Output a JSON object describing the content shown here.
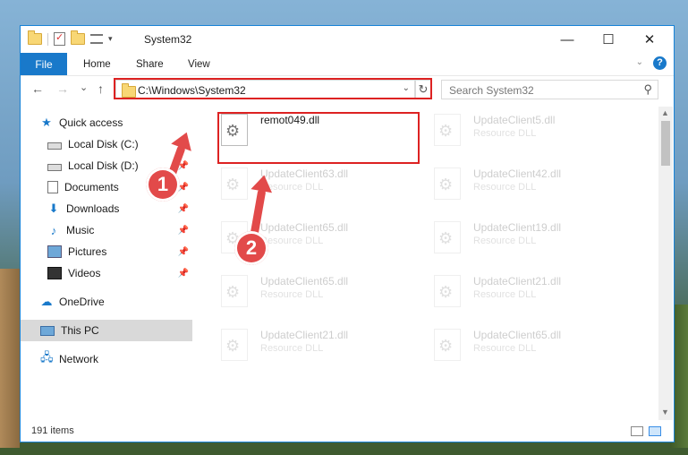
{
  "window": {
    "title": "System32",
    "controls": {
      "minimize": "—",
      "maximize": "☐",
      "close": "✕"
    }
  },
  "ribbon": {
    "tabs": [
      "File",
      "Home",
      "Share",
      "View"
    ],
    "help": "?"
  },
  "navigation": {
    "back": "←",
    "forward": "→",
    "recent": "⌄",
    "up": "↑",
    "address": "C:\\Windows\\System32",
    "refresh": "↻",
    "search_placeholder": "Search System32"
  },
  "sidebar": {
    "quick_access": "Quick access",
    "items": [
      {
        "label": "Local Disk (C:)",
        "icon": "drive-icon",
        "pinned": true
      },
      {
        "label": "Local Disk (D:)",
        "icon": "drive-icon",
        "pinned": true
      },
      {
        "label": "Documents",
        "icon": "documents-icon",
        "pinned": true
      },
      {
        "label": "Downloads",
        "icon": "downloads-icon",
        "pinned": true
      },
      {
        "label": "Music",
        "icon": "music-icon",
        "pinned": true
      },
      {
        "label": "Pictures",
        "icon": "pictures-icon",
        "pinned": true
      },
      {
        "label": "Videos",
        "icon": "videos-icon",
        "pinned": true
      }
    ],
    "onedrive": "OneDrive",
    "this_pc": "This PC",
    "network": "Network"
  },
  "files": [
    {
      "name": "remot049.dll",
      "type": "",
      "highlighted": true
    },
    {
      "name": "UpdateClient5.dll",
      "type": "Resource DLL"
    },
    {
      "name": "UpdateClient63.dll",
      "type": "Resource DLL"
    },
    {
      "name": "UpdateClient42.dll",
      "type": "Resource DLL"
    },
    {
      "name": "UpdateClient65.dll",
      "type": "Resource DLL"
    },
    {
      "name": "UpdateClient19.dll",
      "type": "Resource DLL"
    },
    {
      "name": "UpdateClient65.dll",
      "type": "Resource DLL"
    },
    {
      "name": "UpdateClient21.dll",
      "type": "Resource DLL"
    },
    {
      "name": "UpdateClient21.dll",
      "type": "Resource DLL"
    },
    {
      "name": "UpdateClient65.dll",
      "type": "Resource DLL"
    }
  ],
  "status": {
    "items": "191 items"
  },
  "annotations": {
    "marker1": "1",
    "marker2": "2"
  },
  "colors": {
    "accent": "#1979ca",
    "highlight": "#dd2222",
    "marker": "#e24a4a"
  }
}
